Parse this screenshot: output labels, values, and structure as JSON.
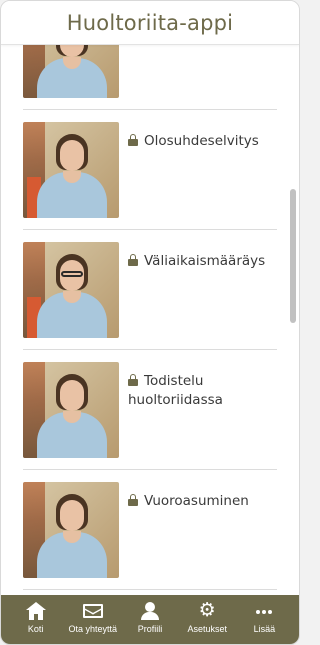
{
  "app": {
    "title": "Huoltoriita-appi"
  },
  "colors": {
    "accent": "#6e6a4a",
    "text": "#3a3a3a",
    "divider": "#dcdcdc"
  },
  "items": [
    {
      "title": "",
      "locked": false,
      "icon": "lock-icon",
      "glasses": false
    },
    {
      "title": "Olosuhdeselvitys",
      "locked": true,
      "icon": "lock-icon",
      "glasses": false
    },
    {
      "title": "Väliaikaismääräys",
      "locked": true,
      "icon": "lock-icon",
      "glasses": true
    },
    {
      "title": "Todistelu huoltoriidassa",
      "locked": true,
      "icon": "lock-icon",
      "glasses": false
    },
    {
      "title": "Vuoroasuminen",
      "locked": true,
      "icon": "lock-icon",
      "glasses": false
    }
  ],
  "tabbar": {
    "tabs": [
      {
        "label": "Koti",
        "icon": "home-icon"
      },
      {
        "label": "Ota yhteyttä",
        "icon": "envelope-icon"
      },
      {
        "label": "Profiili",
        "icon": "user-icon"
      },
      {
        "label": "Asetukset",
        "icon": "gear-icon"
      },
      {
        "label": "Lisää",
        "icon": "more-icon"
      }
    ]
  }
}
